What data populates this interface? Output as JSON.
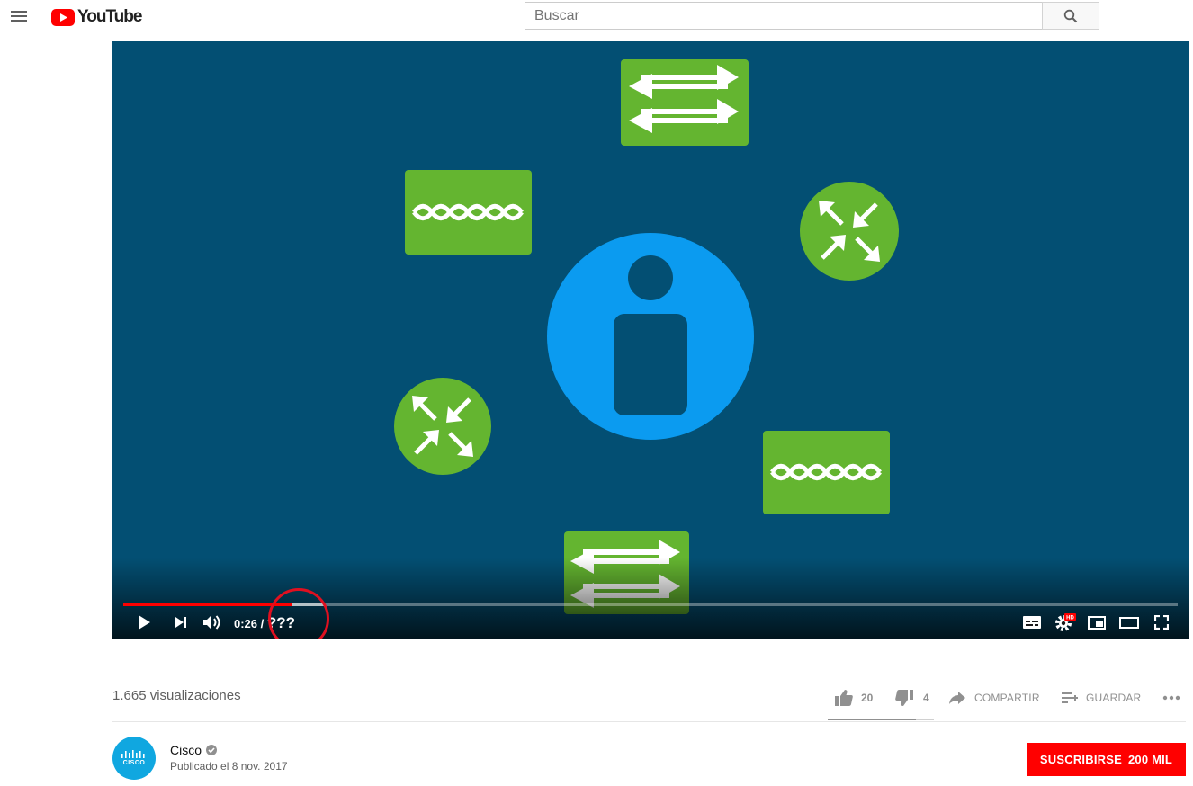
{
  "masthead": {
    "logo_text": "YouTube",
    "search_placeholder": "Buscar",
    "brand_color": "#ff0000"
  },
  "player": {
    "current_time": "0:26 /",
    "duration": "???",
    "played_fraction": 0.16,
    "loaded_fraction": 0.19,
    "background_color": "#034f73",
    "hd_badge": "HD"
  },
  "video_info": {
    "views": "1.665 visualizaciones",
    "likes": "20",
    "dislikes": "4",
    "share_label": "COMPARTIR",
    "save_label": "GUARDAR"
  },
  "channel": {
    "name": "Cisco",
    "avatar_text": "CISCO",
    "published": "Publicado el 8 nov. 2017",
    "subscribe_label": "SUSCRIBIRSE",
    "subscriber_count": "200 MIL"
  }
}
